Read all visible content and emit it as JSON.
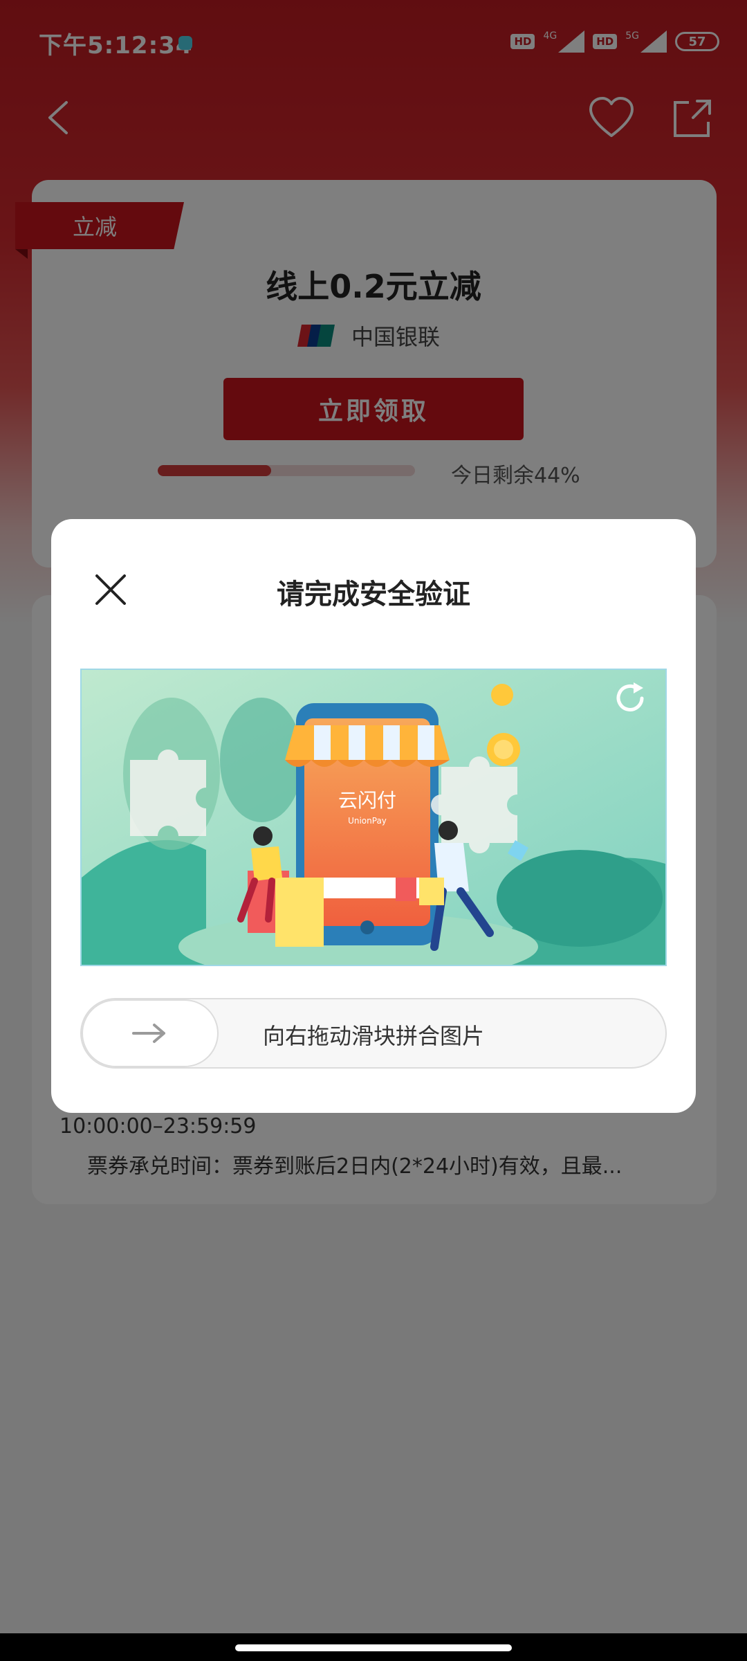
{
  "status_bar": {
    "time": "下午5:12:34",
    "hd1": "HD",
    "net1": "4G",
    "hd2": "HD",
    "net2": "5G",
    "battery": "57"
  },
  "colors": {
    "brand_red": "#c8141c",
    "overlay": "rgba(0,0,0,0.5)"
  },
  "coupon": {
    "badge": "立减",
    "title": "线上0.2元立减",
    "issuer": "中国银联",
    "claim_label": "立即领取",
    "remaining_text": "今日剩余44%",
    "remaining_fraction": 0.44
  },
  "info": {
    "time_range": "10:00:00–23:59:59",
    "redeem_desc": "票券承兑时间：票券到账后2日内(2*24小时)有效，且最..."
  },
  "dialog": {
    "title": "请完成安全验证",
    "puzzle_brand": "云闪付",
    "puzzle_brand_en": "UnionPay",
    "slider_hint": "向右拖动滑块拼合图片"
  },
  "icons": {
    "back": "chevron-left-icon",
    "favorite": "heart-icon",
    "share": "share-icon",
    "close": "close-icon",
    "refresh": "refresh-icon",
    "slider": "arrow-right-icon"
  }
}
